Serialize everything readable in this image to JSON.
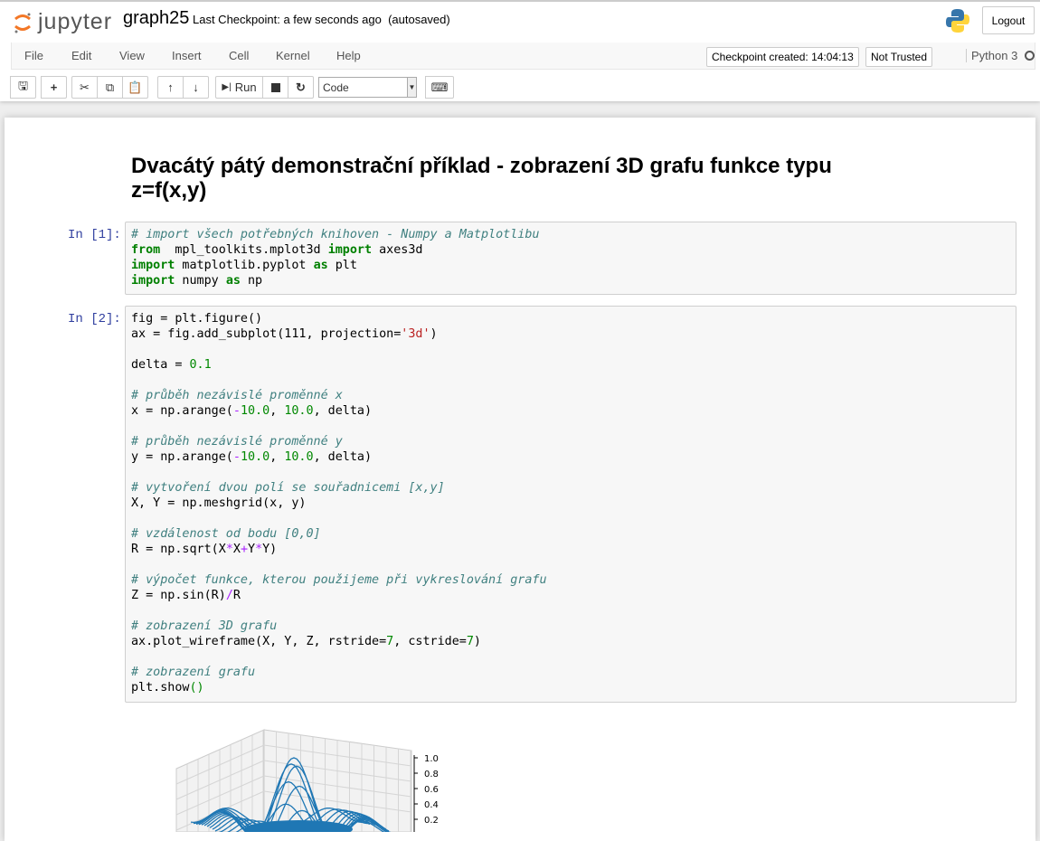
{
  "header": {
    "logo_text": "jupyter",
    "notebook_name": "graph25",
    "checkpoint": "Last Checkpoint: a few seconds ago  (autosaved)",
    "logout": "Logout"
  },
  "menu": [
    "File",
    "Edit",
    "View",
    "Insert",
    "Cell",
    "Kernel",
    "Help"
  ],
  "status": {
    "checkpoint_created": "Checkpoint created: 14:04:13",
    "trust": "Not Trusted",
    "kernel": "Python 3"
  },
  "toolbar": {
    "run": "Run",
    "cell_type": "Code"
  },
  "heading": "Dvacátý pátý demonstrační příklad - zobrazení 3D grafu funkce typu z=f(x,y)",
  "cells": [
    {
      "prompt": "In [1]:",
      "lines": [
        [
          [
            "cm",
            "# import všech potřebných knihoven - Numpy a Matplotlibu"
          ]
        ],
        [
          [
            "kw",
            "from"
          ],
          [
            "",
            "  mpl_toolkits.mplot3d "
          ],
          [
            "kw",
            "import"
          ],
          [
            "",
            " axes3d"
          ]
        ],
        [
          [
            "kw",
            "import"
          ],
          [
            "",
            " matplotlib.pyplot "
          ],
          [
            "kw",
            "as"
          ],
          [
            "",
            " plt"
          ]
        ],
        [
          [
            "kw",
            "import"
          ],
          [
            "",
            " numpy "
          ],
          [
            "kw",
            "as"
          ],
          [
            "",
            " np"
          ]
        ]
      ]
    },
    {
      "prompt": "In [2]:",
      "lines": [
        [
          [
            "",
            "fig = plt.figure()"
          ]
        ],
        [
          [
            "",
            "ax = fig.add_subplot(111, projection="
          ],
          [
            "st",
            "'3d'"
          ],
          [
            "",
            ")"
          ]
        ],
        [],
        [
          [
            "",
            "delta = "
          ],
          [
            "nu",
            "0.1"
          ]
        ],
        [],
        [
          [
            "cm",
            "# průběh nezávislé proměnné x"
          ]
        ],
        [
          [
            "",
            "x = np.arange("
          ],
          [
            "op",
            "-"
          ],
          [
            "nu",
            "10.0"
          ],
          [
            "",
            ", "
          ],
          [
            "nu",
            "10.0"
          ],
          [
            "",
            ", delta)"
          ]
        ],
        [],
        [
          [
            "cm",
            "# průběh nezávislé proměnné y"
          ]
        ],
        [
          [
            "",
            "y = np.arange("
          ],
          [
            "op",
            "-"
          ],
          [
            "nu",
            "10.0"
          ],
          [
            "",
            ", "
          ],
          [
            "nu",
            "10.0"
          ],
          [
            "",
            ", delta)"
          ]
        ],
        [],
        [
          [
            "cm",
            "# vytvoření dvou polí se souřadnicemi [x,y]"
          ]
        ],
        [
          [
            "",
            "X, Y = np.meshgrid(x, y)"
          ]
        ],
        [],
        [
          [
            "cm",
            "# vzdálenost od bodu [0,0]"
          ]
        ],
        [
          [
            "",
            "R = np.sqrt(X"
          ],
          [
            "op",
            "*"
          ],
          [
            "",
            "X"
          ],
          [
            "op",
            "+"
          ],
          [
            "",
            "Y"
          ],
          [
            "op",
            "*"
          ],
          [
            "",
            "Y)"
          ]
        ],
        [],
        [
          [
            "cm",
            "# výpočet funkce, kterou použijeme při vykreslování grafu"
          ]
        ],
        [
          [
            "",
            "Z = np.sin(R)"
          ],
          [
            "op",
            "/"
          ],
          [
            "",
            "R"
          ]
        ],
        [],
        [
          [
            "cm",
            "# zobrazení 3D grafu"
          ]
        ],
        [
          [
            "",
            "ax.plot_wireframe(X, Y, Z, rstride="
          ],
          [
            "nu",
            "7"
          ],
          [
            "",
            ", cstride="
          ],
          [
            "nu",
            "7"
          ],
          [
            "",
            ")"
          ]
        ],
        [],
        [
          [
            "cm",
            "# zobrazení grafu"
          ]
        ],
        [
          [
            "",
            "plt.show"
          ],
          [
            "nu",
            "()"
          ]
        ]
      ]
    }
  ],
  "plot": {
    "z_ticks": [
      "1.0",
      "0.8",
      "0.6",
      "0.4",
      "0.2"
    ],
    "color": "#1f77b4"
  }
}
